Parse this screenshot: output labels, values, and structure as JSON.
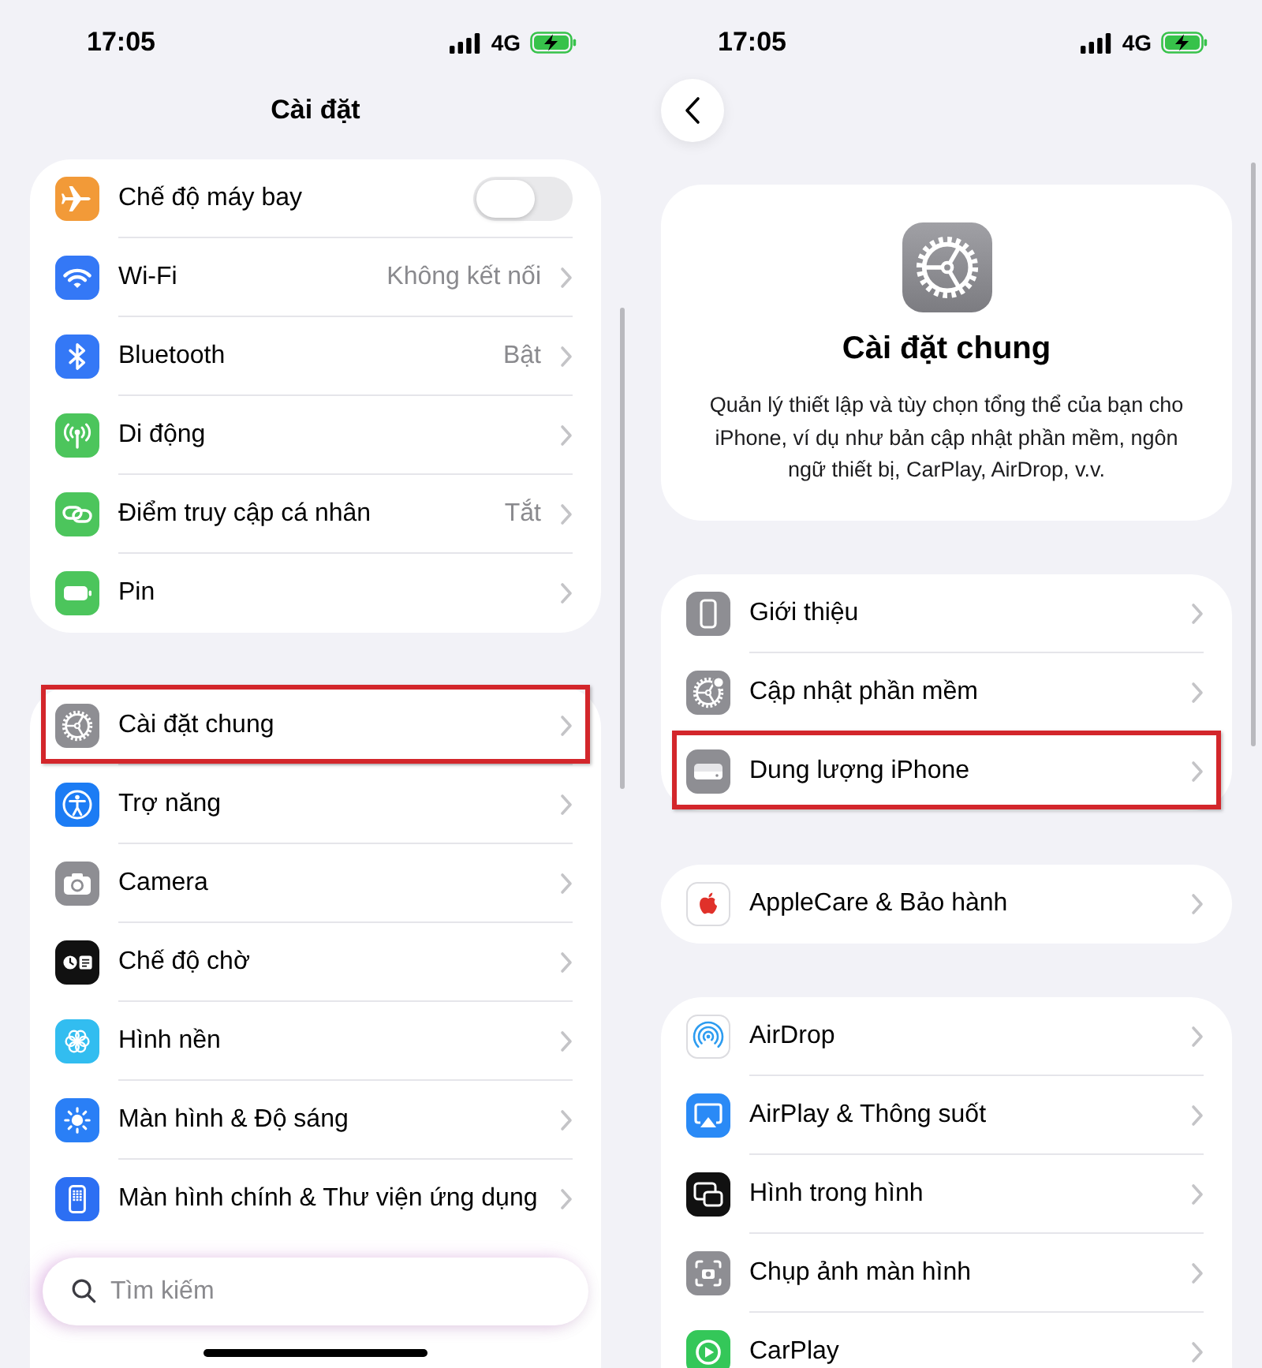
{
  "screens": [
    {
      "kind": "root",
      "status_bar": {
        "time": "17:05",
        "network": "4G"
      },
      "title": "Cài đặt",
      "groups": [
        {
          "rows": [
            {
              "kind": "toggle",
              "label": "Chế độ máy bay",
              "on": false,
              "highlighted": false
            },
            {
              "kind": "link",
              "label": "Wi-Fi",
              "value": "Không kết nối",
              "highlighted": false
            },
            {
              "kind": "link",
              "label": "Bluetooth",
              "value": "Bật",
              "highlighted": false
            },
            {
              "kind": "link",
              "label": "Di động",
              "highlighted": false
            },
            {
              "kind": "link",
              "label": "Điểm truy cập cá nhân",
              "value": "Tắt",
              "highlighted": false
            },
            {
              "kind": "link",
              "label": "Pin",
              "highlighted": false
            }
          ]
        },
        {
          "rows": [
            {
              "kind": "link",
              "label": "Cài đặt chung",
              "highlighted": true
            },
            {
              "kind": "link",
              "label": "Trợ năng",
              "highlighted": false
            },
            {
              "kind": "link",
              "label": "Camera",
              "highlighted": false
            },
            {
              "kind": "link",
              "label": "Chế độ chờ",
              "highlighted": false
            },
            {
              "kind": "link",
              "label": "Hình nền",
              "highlighted": false
            },
            {
              "kind": "link",
              "label": "Màn hình & Độ sáng",
              "highlighted": false
            },
            {
              "kind": "link",
              "label": "Màn hình chính & Thư viện ứng dụng",
              "highlighted": false
            }
          ]
        }
      ],
      "search": {
        "placeholder": "Tìm kiếm"
      }
    },
    {
      "kind": "detail",
      "status_bar": {
        "time": "17:05",
        "network": "4G"
      },
      "header": {
        "title": "Cài đặt chung",
        "description": "Quản lý thiết lập và tùy chọn tổng thể của bạn cho iPhone, ví dụ như bản cập nhật phần mềm, ngôn ngữ thiết bị, CarPlay, AirDrop, v.v."
      },
      "groups": [
        {
          "rows": [
            {
              "kind": "link",
              "label": "Giới thiệu",
              "highlighted": false
            },
            {
              "kind": "link",
              "label": "Cập nhật phần mềm",
              "highlighted": false
            },
            {
              "kind": "link",
              "label": "Dung lượng iPhone",
              "highlighted": true
            }
          ]
        },
        {
          "rows": [
            {
              "kind": "link",
              "label": "AppleCare & Bảo hành",
              "highlighted": false
            }
          ]
        },
        {
          "rows": [
            {
              "kind": "link",
              "label": "AirDrop",
              "highlighted": false
            },
            {
              "kind": "link",
              "label": "AirPlay & Thông suốt",
              "highlighted": false
            },
            {
              "kind": "link",
              "label": "Hình trong hình",
              "highlighted": false
            },
            {
              "kind": "link",
              "label": "Chụp ảnh màn hình",
              "highlighted": false
            },
            {
              "kind": "link",
              "label": "CarPlay",
              "highlighted": false
            }
          ]
        }
      ]
    }
  ]
}
